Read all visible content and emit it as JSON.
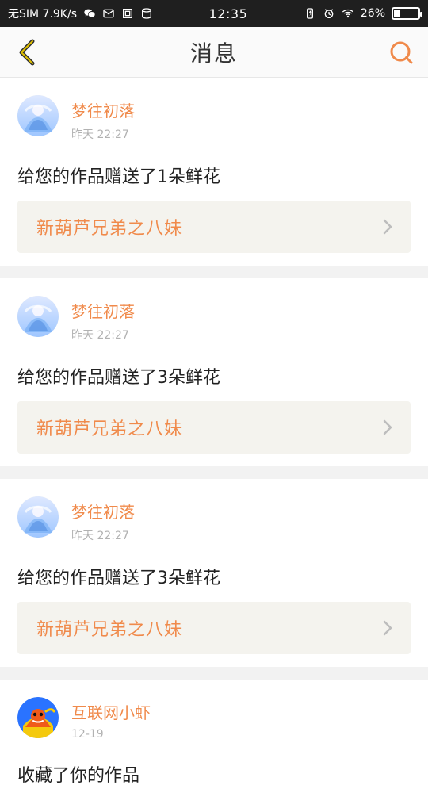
{
  "status_bar": {
    "carrier_net": "无SIM 7.9K/s",
    "time": "12:35",
    "battery": "26%"
  },
  "header": {
    "title": "消息"
  },
  "messages": [
    {
      "name": "梦往初落",
      "time": "昨天 22:27",
      "text": "给您的作品赠送了1朵鲜花",
      "work": "新葫芦兄弟之八妹",
      "avatar": "avatar-dream"
    },
    {
      "name": "梦往初落",
      "time": "昨天 22:27",
      "text": "给您的作品赠送了3朵鲜花",
      "work": "新葫芦兄弟之八妹",
      "avatar": "avatar-dream"
    },
    {
      "name": "梦往初落",
      "time": "昨天 22:27",
      "text": "给您的作品赠送了3朵鲜花",
      "work": "新葫芦兄弟之八妹",
      "avatar": "avatar-dream"
    },
    {
      "name": "互联网小虾",
      "time": "12-19",
      "text": "收藏了你的作品",
      "avatar": "avatar-shrimp"
    }
  ],
  "colors": {
    "accent": "#f08a4b",
    "card_bg": "#ffffff",
    "work_bg": "#f4f3ee",
    "status_bg": "#1f1f1f"
  }
}
